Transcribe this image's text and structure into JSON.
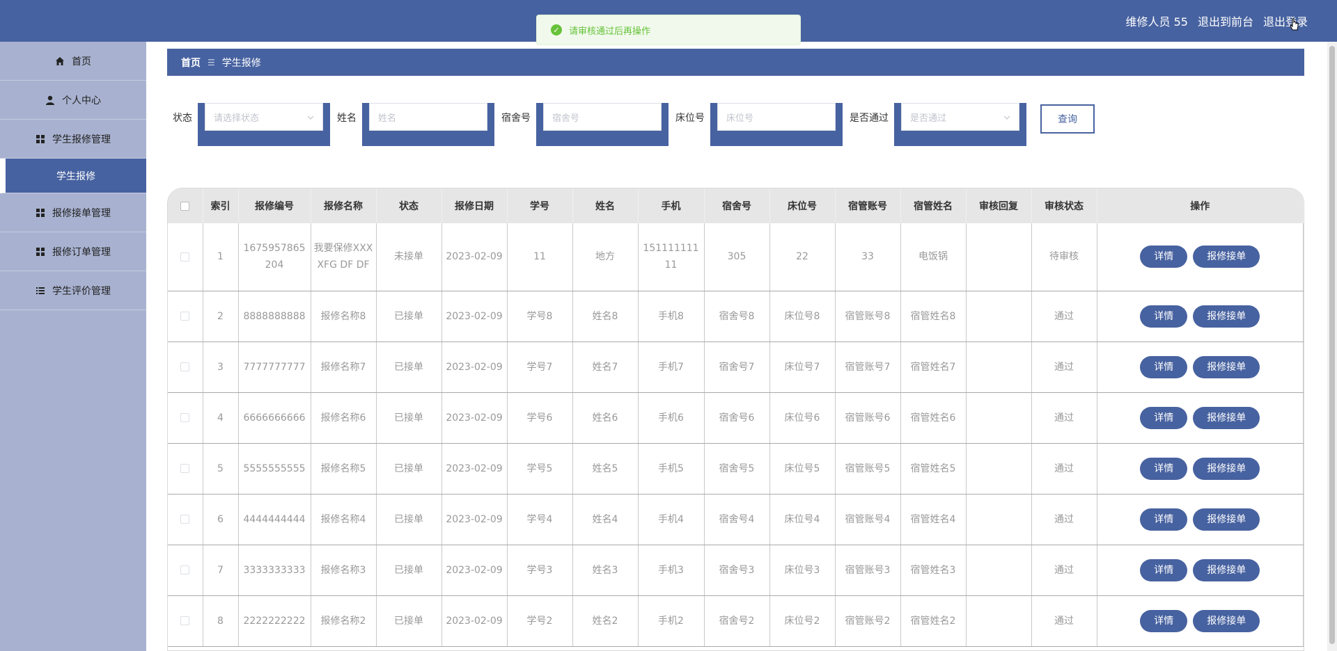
{
  "header": {
    "user_label": "维修人员 55",
    "to_front": "退出到前台",
    "logout": "退出登录"
  },
  "toast": {
    "message": "请审核通过后再操作",
    "icon": "check-circle-icon"
  },
  "sidebar": {
    "items": [
      {
        "label": "首页",
        "icon": "home-icon"
      },
      {
        "label": "个人中心",
        "icon": "user-icon"
      },
      {
        "label": "学生报修管理",
        "icon": "grid-icon"
      },
      {
        "label": "学生报修",
        "icon": ""
      },
      {
        "label": "报修接单管理",
        "icon": "grid-icon"
      },
      {
        "label": "报修订单管理",
        "icon": "grid-icon"
      },
      {
        "label": "学生评价管理",
        "icon": "list-icon"
      }
    ]
  },
  "breadcrumb": {
    "home": "首页",
    "sep": "☰",
    "current": "学生报修"
  },
  "search": {
    "status_label": "状态",
    "status_placeholder": "请选择状态",
    "name_label": "姓名",
    "name_placeholder": "姓名",
    "dorm_label": "宿舍号",
    "dorm_placeholder": "宿舍号",
    "bed_label": "床位号",
    "bed_placeholder": "床位号",
    "pass_label": "是否通过",
    "pass_placeholder": "是否通过",
    "query_button": "查询"
  },
  "table": {
    "columns": [
      "索引",
      "报修编号",
      "报修名称",
      "状态",
      "报修日期",
      "学号",
      "姓名",
      "手机",
      "宿舍号",
      "床位号",
      "宿管账号",
      "宿管姓名",
      "审核回复",
      "审核状态",
      "操作"
    ],
    "detail_button": "详情",
    "accept_button": "报修接单",
    "rows": [
      [
        "1",
        "1675957865204",
        "我要保修XXXXFG DF DF",
        "未接单",
        "2023-02-09",
        "11",
        "地方",
        "15111111111",
        "305",
        "22",
        "33",
        "电饭锅",
        "",
        "待审核"
      ],
      [
        "2",
        "8888888888",
        "报修名称8",
        "已接单",
        "2023-02-09",
        "学号8",
        "姓名8",
        "手机8",
        "宿舍号8",
        "床位号8",
        "宿管账号8",
        "宿管姓名8",
        "",
        "通过"
      ],
      [
        "3",
        "7777777777",
        "报修名称7",
        "已接单",
        "2023-02-09",
        "学号7",
        "姓名7",
        "手机7",
        "宿舍号7",
        "床位号7",
        "宿管账号7",
        "宿管姓名7",
        "",
        "通过"
      ],
      [
        "4",
        "6666666666",
        "报修名称6",
        "已接单",
        "2023-02-09",
        "学号6",
        "姓名6",
        "手机6",
        "宿舍号6",
        "床位号6",
        "宿管账号6",
        "宿管姓名6",
        "",
        "通过"
      ],
      [
        "5",
        "5555555555",
        "报修名称5",
        "已接单",
        "2023-02-09",
        "学号5",
        "姓名5",
        "手机5",
        "宿舍号5",
        "床位号5",
        "宿管账号5",
        "宿管姓名5",
        "",
        "通过"
      ],
      [
        "6",
        "4444444444",
        "报修名称4",
        "已接单",
        "2023-02-09",
        "学号4",
        "姓名4",
        "手机4",
        "宿舍号4",
        "床位号4",
        "宿管账号4",
        "宿管姓名4",
        "",
        "通过"
      ],
      [
        "7",
        "3333333333",
        "报修名称3",
        "已接单",
        "2023-02-09",
        "学号3",
        "姓名3",
        "手机3",
        "宿舍号3",
        "床位号3",
        "宿管账号3",
        "宿管姓名3",
        "",
        "通过"
      ],
      [
        "8",
        "2222222222",
        "报修名称2",
        "已接单",
        "2023-02-09",
        "学号2",
        "姓名2",
        "手机2",
        "宿舍号2",
        "床位号2",
        "宿管账号2",
        "宿管姓名2",
        "",
        "通过"
      ]
    ]
  },
  "colors": {
    "primary": "#4762a0",
    "sidebar": "#a8b2d0",
    "success": "#67c23a"
  }
}
